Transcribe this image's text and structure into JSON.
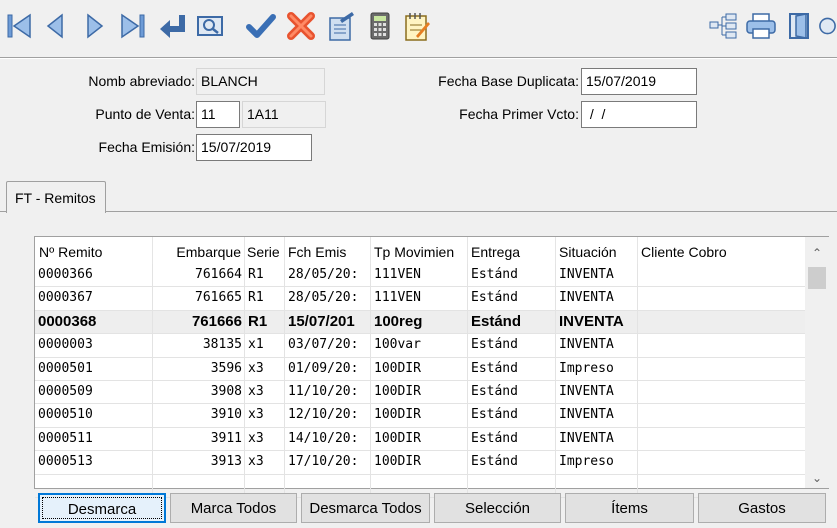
{
  "toolbar": {
    "buttons": [
      {
        "name": "first-record-icon"
      },
      {
        "name": "previous-record-icon"
      },
      {
        "name": "next-record-icon"
      },
      {
        "name": "last-record-icon"
      },
      {
        "name": "enter-return-icon"
      },
      {
        "name": "preview-search-icon"
      },
      {
        "name": "confirm-check-icon"
      },
      {
        "name": "cancel-x-icon"
      },
      {
        "name": "edit-document-icon"
      },
      {
        "name": "calculator-icon"
      },
      {
        "name": "notepad-edit-icon"
      },
      {
        "name": "tree-structure-icon"
      },
      {
        "name": "printer-icon"
      },
      {
        "name": "exit-door-icon"
      },
      {
        "name": "help-icon"
      }
    ]
  },
  "form": {
    "nomb_abreviado": {
      "label": "Nomb abreviado:",
      "value": "BLANCH"
    },
    "punto_venta": {
      "label": "Punto de Venta:",
      "value": "11",
      "desc": "1A11"
    },
    "fecha_emision": {
      "label": "Fecha Emisión:",
      "value": "15/07/2019"
    },
    "fecha_base_duplicata": {
      "label": "Fecha Base Duplicata:",
      "value": "15/07/2019"
    },
    "fecha_primer_vcto": {
      "label": "Fecha Primer Vcto:",
      "value": " /  /"
    }
  },
  "tabs": [
    {
      "label": "FT - Remitos"
    }
  ],
  "grid": {
    "columns": [
      "Nº Remito",
      "Embarque",
      "Serie",
      "Fch Emis",
      "Tp Movimien",
      "Entrega",
      "Situación",
      "Cliente Cobro"
    ],
    "rows": [
      [
        "0000366",
        "761664",
        "R1",
        "28/05/20:",
        "111VEN",
        "Estánd",
        "INVENTA",
        ""
      ],
      [
        "0000367",
        "761665",
        "R1",
        "28/05/20:",
        "111VEN",
        "Estánd",
        "INVENTA",
        ""
      ],
      [
        "0000368",
        "761666",
        "R1",
        "15/07/201",
        "100reg",
        "Estánd",
        "INVENTA",
        ""
      ],
      [
        "0000003",
        "38135",
        "x1",
        "03/07/20:",
        "100var",
        "Estánd",
        "INVENTA",
        ""
      ],
      [
        "0000501",
        "3596",
        "x3",
        "01/09/20:",
        "100DIR",
        "Estánd",
        "Impreso",
        ""
      ],
      [
        "0000509",
        "3908",
        "x3",
        "11/10/20:",
        "100DIR",
        "Estánd",
        "INVENTA",
        ""
      ],
      [
        "0000510",
        "3910",
        "x3",
        "12/10/20:",
        "100DIR",
        "Estánd",
        "INVENTA",
        ""
      ],
      [
        "0000511",
        "3911",
        "x3",
        "14/10/20:",
        "100DIR",
        "Estánd",
        "INVENTA",
        ""
      ],
      [
        "0000513",
        "3913",
        "x3",
        "17/10/20:",
        "100DIR",
        "Estánd",
        "Impreso",
        ""
      ],
      [
        "",
        "",
        "",
        "",
        "",
        "",
        "",
        ""
      ]
    ],
    "selected_row": 2
  },
  "buttons": {
    "desmarca": "Desmarca",
    "marca_todos": "Marca Todos",
    "desmarca_todos": "Desmarca Todos",
    "seleccion": "Selección",
    "items": "Ítems",
    "gastos": "Gastos"
  },
  "colors": {
    "nav_arrow": "#4a7fc1",
    "check": "#3a6fb5",
    "cancel": "#e8532f",
    "focus_border": "#0078d7"
  }
}
